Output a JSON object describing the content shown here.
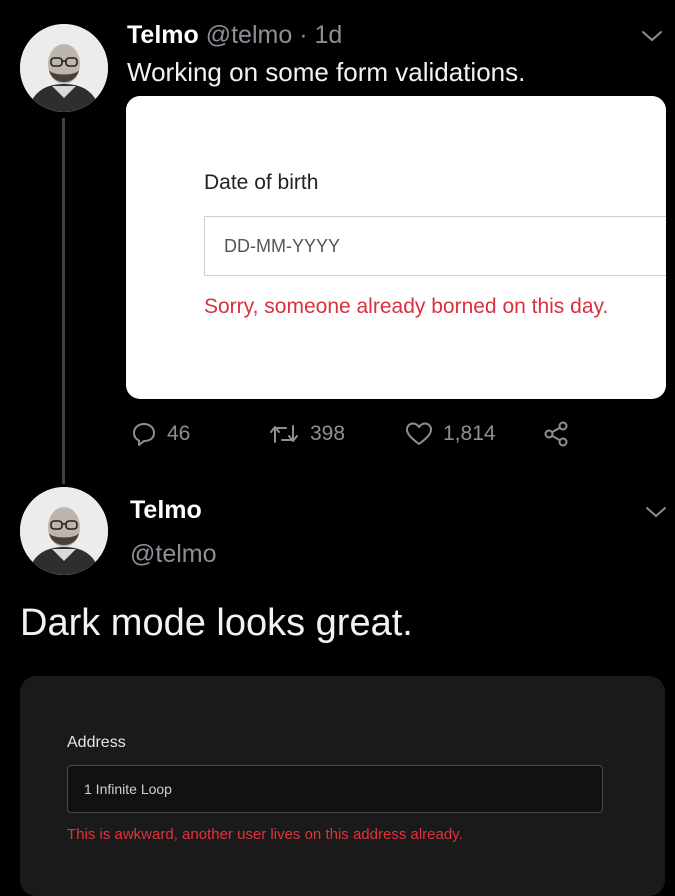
{
  "tweet1": {
    "name": "Telmo",
    "handle": "@telmo",
    "separator": "·",
    "time": "1d",
    "text": "Working on some form validations.",
    "card": {
      "label": "Date of birth",
      "placeholder": "DD-MM-YYYY",
      "error": "Sorry, someone already borned on this day."
    },
    "actions": {
      "replies": "46",
      "retweets": "398",
      "likes": "1,814"
    }
  },
  "tweet2": {
    "name": "Telmo",
    "handle": "@telmo",
    "text": "Dark mode looks great.",
    "card": {
      "label": "Address",
      "value": "1 Infinite Loop",
      "error": "This is awkward, another user lives on this address already."
    }
  },
  "colors": {
    "background": "#000000",
    "muted": "#8b9096",
    "error": "#d8323e"
  },
  "icons": [
    "chevron-down-icon",
    "reply-icon",
    "retweet-icon",
    "like-icon",
    "share-icon"
  ]
}
